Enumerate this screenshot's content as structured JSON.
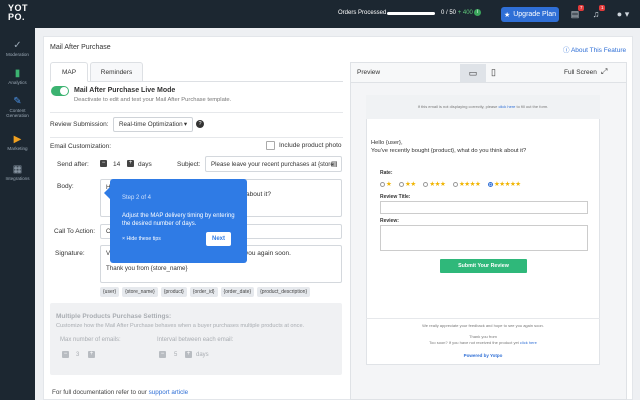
{
  "topbar": {
    "logo_line1": "YOT",
    "logo_line2": "PO.",
    "orders_label": "Orders Processed",
    "orders_progress": 0.0,
    "orders_count": "0 / 50",
    "orders_plus": "+ 400",
    "upgrade_label": "Upgrade Plan",
    "notif_badge_1": "7",
    "notif_badge_2": "1",
    "accent": "#2f6fd6"
  },
  "sidebar": {
    "items": [
      {
        "label": "Moderation",
        "icon": "moderation-icon"
      },
      {
        "label": "Analytics",
        "icon": "analytics-icon"
      },
      {
        "label": "Content Generation",
        "icon": "content-generation-icon"
      },
      {
        "label": "Marketing",
        "icon": "marketing-icon"
      },
      {
        "label": "Integrations",
        "icon": "integrations-icon"
      }
    ]
  },
  "page": {
    "title": "Mail After Purchase",
    "about_link": "About This Feature"
  },
  "tabs": [
    {
      "label": "MAP",
      "active": true
    },
    {
      "label": "Reminders",
      "active": false
    }
  ],
  "live_mode": {
    "label": "Mail After Purchase Live Mode",
    "description": "Deactivate to edit and test your Mail After Purchase template.",
    "enabled": true
  },
  "review_submission": {
    "label": "Review Submission:",
    "value": "Real-time Optimization"
  },
  "email_customization": {
    "label": "Email Customization:",
    "include_photo_label": "Include product photo",
    "send_after_label": "Send after:",
    "send_after_value": "14",
    "send_after_unit": "days",
    "subject_label": "Subject:",
    "subject_value": "Please leave your recent purchases at {store",
    "body_label": "Body:",
    "body_visible_start": "H",
    "body_visible_start2": "Y",
    "body_visible_end": "about it?",
    "cta_label": "Call To Action:",
    "cta_visible": "C",
    "signature_label": "Signature:",
    "signature_visible_start": "V",
    "signature_visible_end": "you again soon.",
    "signature_line2": "Thank you from {store_name}",
    "tags": [
      "{user}",
      "{store_name}",
      "{product}",
      "{order_id}",
      "{order_date}",
      "{product_description}"
    ]
  },
  "multi_products": {
    "title": "Multiple Products Purchase Settings:",
    "description": "Customize how the Mail After Purchase behaves when a buyer purchases multiple products at once.",
    "max_emails_label": "Max number of emails:",
    "max_emails_value": "3",
    "interval_label": "Interval between each email:",
    "interval_value": "5",
    "interval_unit": "days"
  },
  "footer": {
    "text": "For full documentation refer to our",
    "link": "support article"
  },
  "tour": {
    "step": "Step 2 of 4",
    "text": "Adjust the MAP delivery timing by entering the desired number of days.",
    "hide_label": "Hide these tips",
    "next_label": "Next"
  },
  "preview": {
    "label": "Preview",
    "fullscreen_label": "Full Screen",
    "top_notice": "If this email is not displaying correctly, please",
    "top_notice_link": "click here",
    "top_notice_end": "to fill out the form.",
    "greeting": "Hello {user},",
    "intro": "You've recently bought {product}, what do you think about it?",
    "rate_label": "Rate:",
    "ratings": [
      1,
      2,
      3,
      4,
      5
    ],
    "selected_rating": 5,
    "review_title_label": "Review Title:",
    "review_label": "Review:",
    "submit_label": "Submit Your Review",
    "footer_line1": "We really appreciate your feedback and hope to see you again soon.",
    "footer_line2": "Thank you from",
    "footer_line3": "Too soon? If you have not received the product yet",
    "footer_line3_link": "click here",
    "powered_by": "Powered by Yotpo"
  }
}
